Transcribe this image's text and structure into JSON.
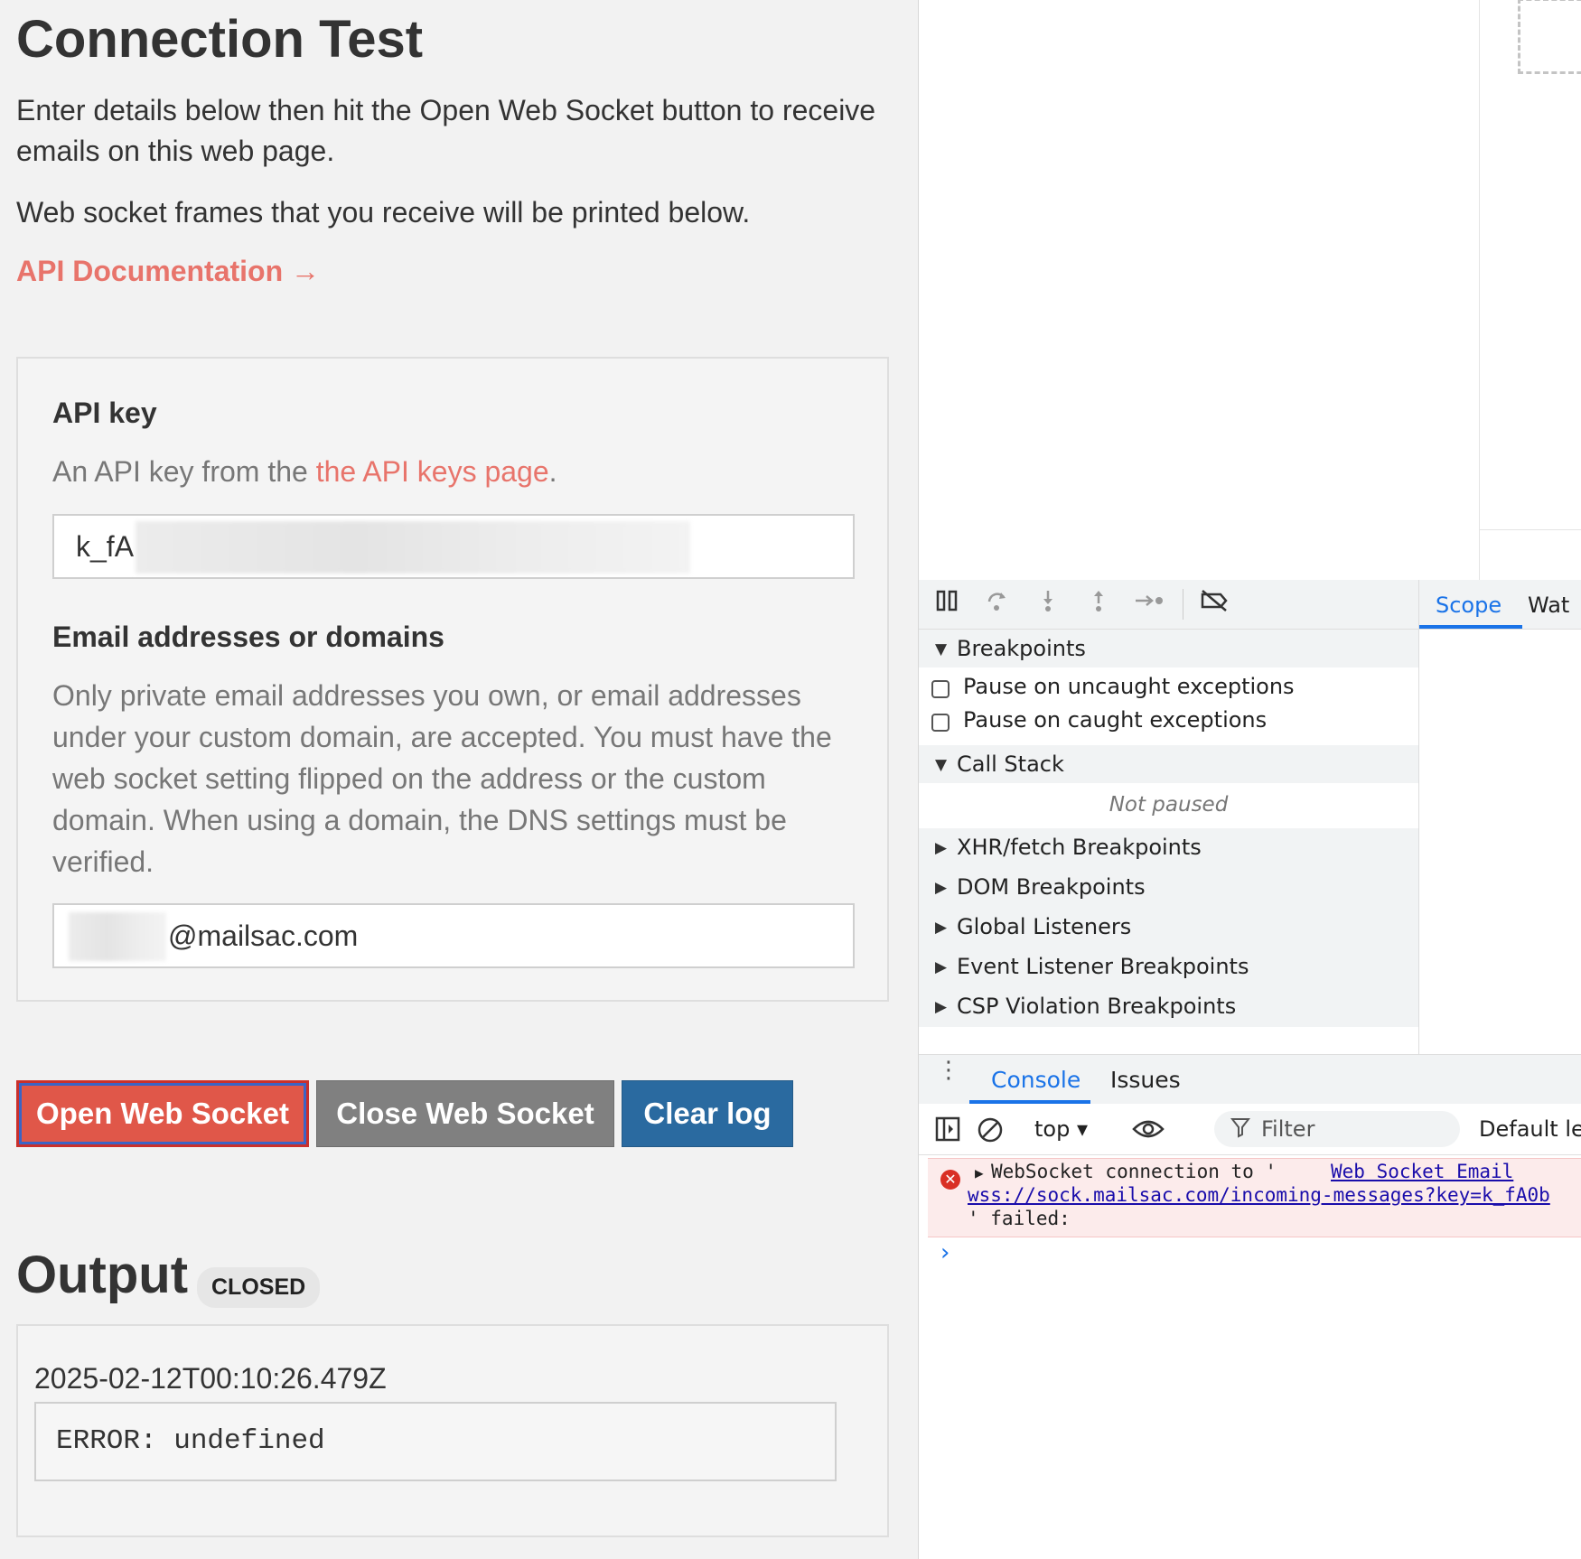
{
  "page": {
    "title": "Connection Test",
    "intro": "Enter details below then hit the Open Web Socket button to receive emails on this web page.",
    "frames_note": "Web socket frames that you receive will be printed below.",
    "doc_link": "API Documentation →"
  },
  "api_key": {
    "label": "API key",
    "help_prefix": "An API key from the ",
    "help_link": "the API keys page",
    "help_suffix": ".",
    "value": "k_fA"
  },
  "emails": {
    "label": "Email addresses or domains",
    "help": "Only private email addresses you own, or email addresses under your custom domain, are accepted. You must have the web socket setting flipped on the address or the custom domain. When using a domain, the DNS settings must be verified.",
    "value": "@mailsac.com"
  },
  "buttons": {
    "open": "Open Web Socket",
    "close": "Close Web Socket",
    "clear": "Clear log"
  },
  "output": {
    "title": "Output",
    "status": "CLOSED",
    "timestamp": "2025-02-12T00:10:26.479Z",
    "message": "ERROR: undefined"
  },
  "devtools": {
    "scope_tabs": [
      "Scope",
      "Wat"
    ],
    "breakpoints": "Breakpoints",
    "pause_uncaught": "Pause on uncaught exceptions",
    "pause_caught": "Pause on caught exceptions",
    "call_stack": "Call Stack",
    "not_paused": "Not paused",
    "sections": [
      "XHR/fetch Breakpoints",
      "DOM Breakpoints",
      "Global Listeners",
      "Event Listener Breakpoints",
      "CSP Violation Breakpoints"
    ],
    "console_tab": "Console",
    "issues_tab": "Issues",
    "context": "top ▾",
    "filter": "Filter",
    "levels": "Default lev",
    "error_line1": "WebSocket connection to '",
    "error_source": "Web Socket Email ",
    "error_url": "wss://sock.mailsac.com/incoming-messages?key=k_fA0b",
    "error_line3": "' failed:"
  },
  "colors": {
    "accent": "#e8746b",
    "open_button": "#e05749",
    "close_button": "#808080",
    "clear_button": "#2a6aa0",
    "devtools_blue": "#1a73e8"
  }
}
